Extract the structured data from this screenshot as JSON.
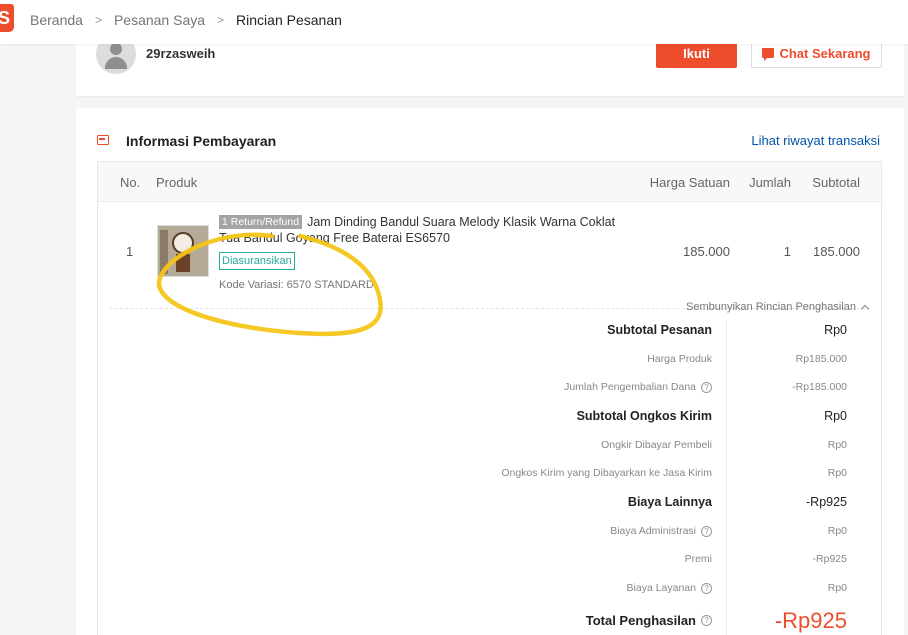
{
  "breadcrumb": {
    "items": [
      "Beranda",
      "Pesanan Saya"
    ],
    "current": "Rincian Pesanan",
    "separator": ">"
  },
  "logo": {
    "glyph": "S"
  },
  "seller": {
    "name": "29rzasweih",
    "follow_label": "Ikuti",
    "chat_label": "Chat Sekarang"
  },
  "payment": {
    "title": "Informasi Pembayaran",
    "history_link": "Lihat riwayat transaksi",
    "columns": {
      "no": "No.",
      "product": "Produk",
      "unit_price": "Harga Satuan",
      "qty": "Jumlah",
      "subtotal": "Subtotal"
    },
    "item": {
      "no": "1",
      "refund_badge": "1 Return/Refund",
      "name": "Jam Dinding Bandul Suara Melody Klasik Warna Coklat Tua Bandul Goyang Free Baterai ES6570",
      "insured_badge": "Diasuransikan",
      "variation": "Kode Variasi: 6570 STANDARD",
      "unit_price": "185.000",
      "qty": "1",
      "subtotal": "185.000"
    },
    "hide_toggle": "Sembunyikan Rincian Penghasilan",
    "summary": [
      {
        "label": "Subtotal Pesanan",
        "value": "Rp0",
        "kind": "major",
        "info": false
      },
      {
        "label": "Harga Produk",
        "value": "Rp185.000",
        "kind": "minor",
        "info": false
      },
      {
        "label": "Jumlah Pengembalian Dana",
        "value": "-Rp185.000",
        "kind": "minor",
        "info": true
      },
      {
        "label": "Subtotal Ongkos Kirim",
        "value": "Rp0",
        "kind": "major",
        "info": false
      },
      {
        "label": "Ongkir Dibayar Pembeli",
        "value": "Rp0",
        "kind": "minor",
        "info": false
      },
      {
        "label": "Ongkos Kirim yang Dibayarkan ke Jasa Kirim",
        "value": "Rp0",
        "kind": "minor",
        "info": false
      },
      {
        "label": "Biaya Lainnya",
        "value": "-Rp925",
        "kind": "major",
        "info": false
      },
      {
        "label": "Biaya Administrasi",
        "value": "Rp0",
        "kind": "minor",
        "info": true
      },
      {
        "label": "Premi",
        "value": "-Rp925",
        "kind": "minor",
        "info": false
      },
      {
        "label": "Biaya Layanan",
        "value": "Rp0",
        "kind": "minor",
        "info": true
      },
      {
        "label": "Total Penghasilan",
        "value": "-Rp925",
        "kind": "total",
        "info": true
      }
    ]
  },
  "colors": {
    "brand": "#ee4d2d",
    "link": "#0055aa",
    "insured": "#26aa99",
    "annotation": "#f5c518"
  },
  "icons": [
    "shopee-logo-icon",
    "chevron-right-icon",
    "user-avatar-icon",
    "chat-icon",
    "payment-info-icon",
    "chevron-up-icon",
    "question-icon"
  ]
}
